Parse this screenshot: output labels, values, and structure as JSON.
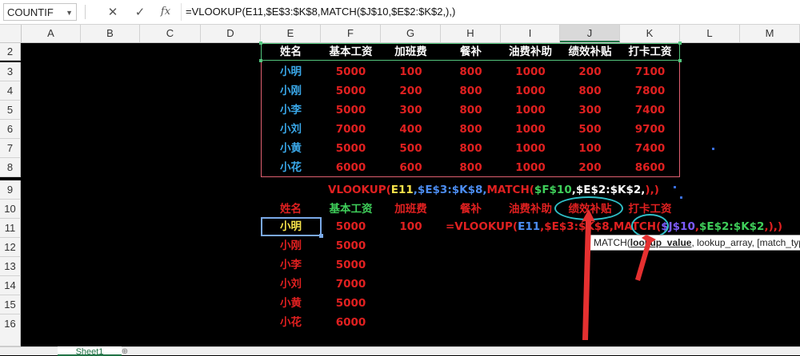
{
  "formula_bar": {
    "name_box": "COUNTIF",
    "cancel_icon": "✕",
    "enter_icon": "✓",
    "fx_icon": "fx",
    "formula": "=VLOOKUP(E11,$E$3:$K$8,MATCH($J$10,$E$2:$K$2,),)"
  },
  "columns": [
    "A",
    "B",
    "C",
    "D",
    "E",
    "F",
    "G",
    "H",
    "I",
    "J",
    "K",
    "L",
    "M"
  ],
  "rows": [
    "2",
    "3",
    "4",
    "5",
    "6",
    "7",
    "8",
    "9",
    "10",
    "11",
    "12",
    "13",
    "14",
    "15",
    "16"
  ],
  "table": {
    "headers": [
      "姓名",
      "基本工资",
      "加班费",
      "餐补",
      "油费补助",
      "绩效补贴",
      "打卡工资"
    ],
    "rows": [
      [
        "小明",
        "5000",
        "100",
        "800",
        "1000",
        "200",
        "7100"
      ],
      [
        "小刚",
        "5000",
        "200",
        "800",
        "1000",
        "800",
        "7800"
      ],
      [
        "小李",
        "5000",
        "300",
        "800",
        "1000",
        "300",
        "7400"
      ],
      [
        "小刘",
        "7000",
        "400",
        "800",
        "1000",
        "500",
        "9700"
      ],
      [
        "小黄",
        "5000",
        "500",
        "800",
        "1000",
        "100",
        "7400"
      ],
      [
        "小花",
        "6000",
        "600",
        "800",
        "1000",
        "200",
        "8600"
      ]
    ]
  },
  "annotation_formula": {
    "p1": "VLOOKUP(",
    "p2": "E11",
    "p3": ",$E$3:$K$8,",
    "p4": "MATCH(",
    "p5": "$F$10",
    "p6": ",$E$2:$K$2,",
    "p7": "),)"
  },
  "lower_headers": [
    "姓名",
    "基本工资",
    "加班费",
    "餐补",
    "油费补助",
    "绩效补贴",
    "打卡工资"
  ],
  "lower_rows": [
    [
      "小明",
      "5000",
      "100"
    ],
    [
      "小刚",
      "5000"
    ],
    [
      "小李",
      "5000"
    ],
    [
      "小刘",
      "7000"
    ],
    [
      "小黄",
      "5000"
    ],
    [
      "小花",
      "6000"
    ]
  ],
  "edit_formula": {
    "p1": "=VLOOKUP(",
    "p2": "E11",
    "p3": ",",
    "p4": "$E$3:$K$8",
    "p5": ",MATCH(",
    "p6": "$J$10",
    "p7": ",",
    "p8": "$E$2:$K$2",
    "p9": ",),)"
  },
  "tooltip": {
    "fn": "MATCH(",
    "arg1": "lookup_value",
    "rest": ", lookup_array, [match_type"
  },
  "sheet_tab": "Sheet1",
  "add_sheet_icon": "⊕",
  "colors": {
    "green_frame": "#53c57d",
    "red_frame": "#e06070",
    "ring": "#2fbfc7",
    "arrow": "#e02020"
  }
}
